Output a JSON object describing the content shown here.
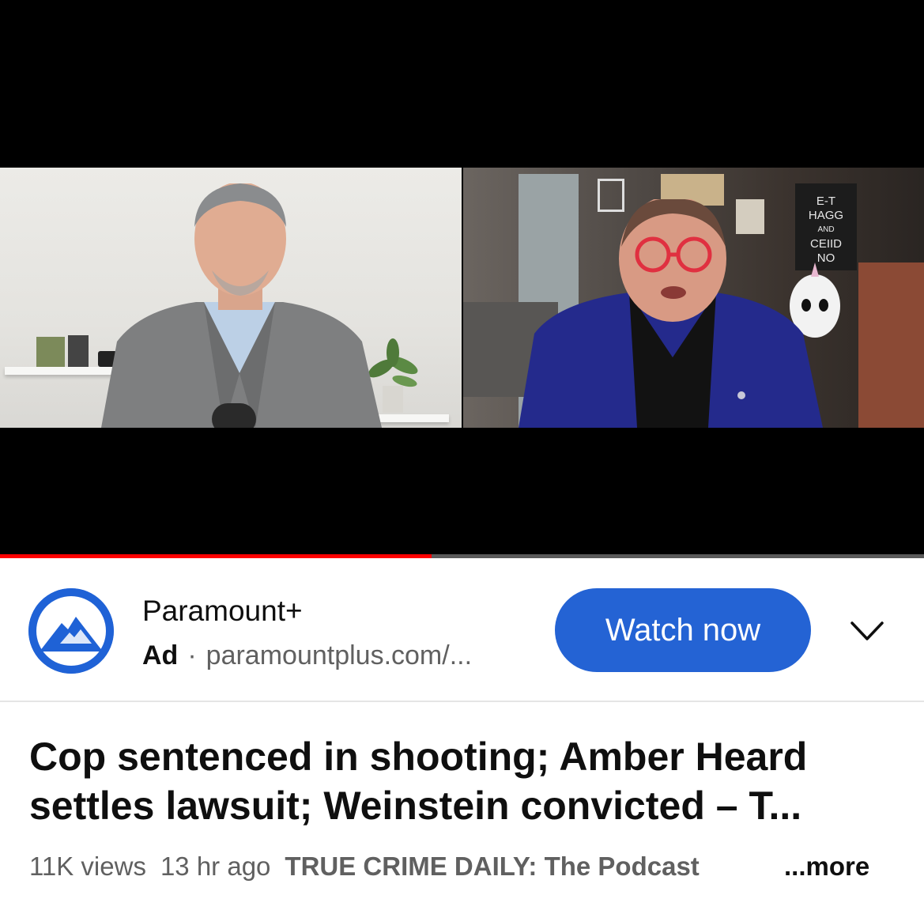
{
  "ad": {
    "advertiser": "Paramount+",
    "label": "Ad",
    "separator": "·",
    "url": "paramountplus.com/...",
    "cta": "Watch now",
    "logo_icon": "paramount-mountain-icon",
    "expand_icon": "chevron-down-icon",
    "brand_color": "#2463d4"
  },
  "video": {
    "progress_fraction": 0.467,
    "progress_color": "#ff0000",
    "title": "Cop sentenced in shooting; Amber Heard settles lawsuit; Weinstein convicted – T...",
    "views": "11K views",
    "age": "13 hr ago",
    "channel": "TRUE CRIME DAILY: The Podcast",
    "more_label": "...more"
  },
  "frame": {
    "poster_text_lines": [
      "E-T",
      "HAGG",
      "AND",
      "CEIID",
      "NO"
    ]
  }
}
